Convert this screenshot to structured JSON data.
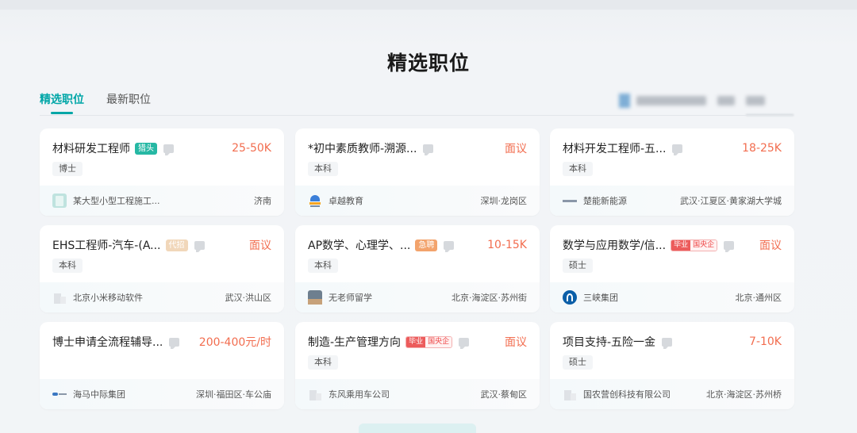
{
  "section": {
    "title": "精选职位"
  },
  "tabs": [
    {
      "label": "精选职位",
      "active": true
    },
    {
      "label": "最新职位",
      "active": false
    }
  ],
  "jobs": [
    {
      "title": "材料研发工程师",
      "badge": {
        "type": "green",
        "label": "猎头"
      },
      "salary": "25-50K",
      "tag": "博士",
      "company": "某大型小型工程施工...",
      "location": "济南",
      "logo": "building-icon-teal"
    },
    {
      "title": "*初中素质教师-溯源...",
      "badge": null,
      "salary": "面议",
      "tag": "本科",
      "company": "卓越教育",
      "location": "深圳·龙岗区",
      "logo": "zhuoyue-logo"
    },
    {
      "title": "材料开发工程师-五...",
      "badge": null,
      "salary": "18-25K",
      "tag": "本科",
      "company": "楚能新能源",
      "location": "武汉·江夏区·黄家湖大学城",
      "logo": "chuneng-logo"
    },
    {
      "title": "EHS工程师-汽车-(A...",
      "badge": {
        "type": "tan",
        "label": "代招"
      },
      "salary": "面议",
      "tag": "本科",
      "company": "北京小米移动软件",
      "location": "武汉·洪山区",
      "logo": "building-icon-gray"
    },
    {
      "title": "AP数学、心理学、...",
      "badge": {
        "type": "orange",
        "label": "急聘"
      },
      "salary": "10-15K",
      "tag": "本科",
      "company": "无老师留学",
      "location": "北京·海淀区·苏州街",
      "logo": "photo-logo"
    },
    {
      "title": "数学与应用数学/信...",
      "badge": {
        "type": "pair",
        "label": "毕业",
        "label2": "国央企"
      },
      "salary": "面议",
      "tag": "硕士",
      "company": "三峡集团",
      "location": "北京·通州区",
      "logo": "sanxia-logo"
    },
    {
      "title": "博士申请全流程辅导...",
      "badge": null,
      "salary": "200-400元/时",
      "tag": "",
      "company": "海马中际集团",
      "location": "深圳·福田区·车公庙",
      "logo": "haima-logo"
    },
    {
      "title": "制造-生产管理方向",
      "badge": {
        "type": "pair",
        "label": "毕业",
        "label2": "国央企"
      },
      "salary": "面议",
      "tag": "本科",
      "company": "东风乘用车公司",
      "location": "武汉·蔡甸区",
      "logo": "building-icon-gray"
    },
    {
      "title": "项目支持-五险一金",
      "badge": null,
      "salary": "7-10K",
      "tag": "硕士",
      "company": "国农营创科技有限公司",
      "location": "北京·海淀区·苏州桥",
      "logo": "building-icon-gray"
    }
  ],
  "colors": {
    "accent": "#00a6a7",
    "salary": "#f26d4f"
  }
}
